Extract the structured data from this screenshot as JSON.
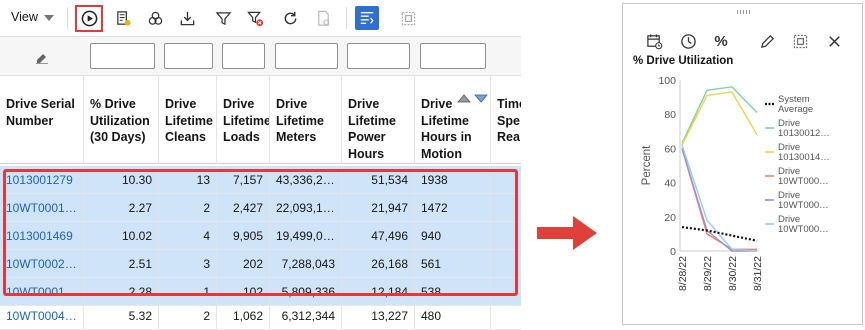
{
  "toolbar": {
    "view_label": "View"
  },
  "table": {
    "headers": [
      "Drive Serial Number",
      "% Drive Utilization (30 Days)",
      "Drive Lifetime Cleans",
      "Drive Lifetime Loads",
      "Drive Lifetime Meters",
      "Drive Lifetime Power Hours",
      "Drive Lifetime Hours in Motion",
      "Time Spe Rea"
    ],
    "rows": [
      [
        "1013001279",
        "10.30",
        "13",
        "7,157",
        "43,336,2…",
        "51,534",
        "1938"
      ],
      [
        "10WT0001…",
        "2.27",
        "2",
        "2,427",
        "22,093,1…",
        "21,947",
        "1472"
      ],
      [
        "1013001469",
        "10.02",
        "4",
        "9,905",
        "19,499,0…",
        "47,496",
        "940"
      ],
      [
        "10WT0002…",
        "2.51",
        "3",
        "202",
        "7,288,043",
        "26,168",
        "561"
      ],
      [
        "10WT0001…",
        "2.28",
        "1",
        "102",
        "5,809,336",
        "12,184",
        "538"
      ],
      [
        "10WT0004…",
        "5.32",
        "2",
        "1,062",
        "6,312,344",
        "13,227",
        "480"
      ]
    ]
  },
  "chart_panel": {
    "percent_symbol": "%",
    "title": "% Drive Utilization"
  },
  "chart_data": {
    "type": "line",
    "title": "% Drive Utilization",
    "ylabel": "Percent",
    "xlabel": "",
    "ylim": [
      0,
      100
    ],
    "y_ticks": [
      "0",
      "20",
      "40",
      "60",
      "80",
      "100"
    ],
    "categories": [
      "8/28/22",
      "8/29/22",
      "8/30/22",
      "8/31/22"
    ],
    "grid": false,
    "legend_position": "right",
    "series": [
      {
        "name": "System Average",
        "color": "#111111",
        "dashed": true,
        "values": [
          14,
          12,
          9,
          6
        ]
      },
      {
        "name": "Drive 10130012…",
        "color": "#7fd1a8",
        "values": [
          63,
          94,
          96,
          81
        ]
      },
      {
        "name": "Drive 10130014…",
        "color": "#e8d44d",
        "values": [
          62,
          91,
          93,
          68
        ]
      },
      {
        "name": "Drive 10WT000…",
        "color": "#e8836a",
        "values": [
          60,
          10,
          1,
          1
        ]
      },
      {
        "name": "Drive 10WT000…",
        "color": "#a98ac8",
        "values": [
          60,
          12,
          0,
          0
        ]
      },
      {
        "name": "Drive 10WT000…",
        "color": "#8fd0e8",
        "values": [
          62,
          18,
          1,
          0
        ]
      }
    ]
  }
}
